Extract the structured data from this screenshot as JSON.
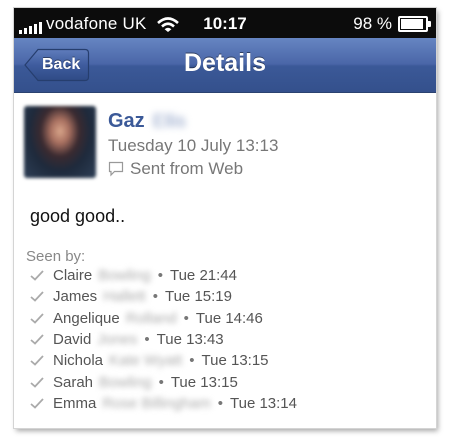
{
  "status_bar": {
    "carrier": "vodafone UK",
    "time": "10:17",
    "battery_percent": "98 %",
    "battery_level": 0.98
  },
  "nav": {
    "back_label": "Back",
    "title": "Details"
  },
  "post": {
    "author_first": "Gaz",
    "author_last": "Ellis",
    "timestamp": "Tuesday 10 July 13:13",
    "source": "Sent from Web",
    "message": "good good.."
  },
  "seen": {
    "label": "Seen by:",
    "people": [
      {
        "first": "Claire",
        "last": "Bowling",
        "time": "Tue 21:44"
      },
      {
        "first": "James",
        "last": "Hallett",
        "time": "Tue 15:19"
      },
      {
        "first": "Angelique",
        "last": "Rolland",
        "time": "Tue 14:46"
      },
      {
        "first": "David",
        "last": "Jones",
        "time": "Tue 13:43"
      },
      {
        "first": "Nichola",
        "last": "Kate Wyatt",
        "time": "Tue 13:15"
      },
      {
        "first": "Sarah",
        "last": "Bowling",
        "time": "Tue 13:15"
      },
      {
        "first": "Emma",
        "last": "Rose Billingham",
        "time": "Tue 13:14"
      }
    ]
  }
}
